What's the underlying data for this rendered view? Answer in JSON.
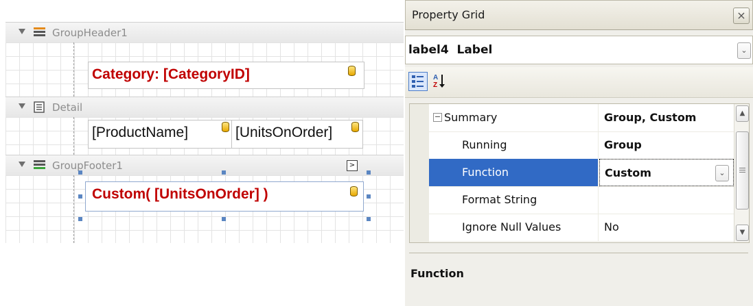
{
  "designer": {
    "bands": [
      {
        "name": "GroupHeader1"
      },
      {
        "name": "Detail"
      },
      {
        "name": "GroupFooter1"
      }
    ],
    "controls": {
      "category": "Category: [CategoryID]",
      "product_name": "[ProductName]",
      "units_on_order": "[UnitsOnOrder]",
      "custom_summary": "Custom( [UnitsOnOrder] )"
    },
    "smart_tag_glyph": ">"
  },
  "property_grid": {
    "title": "Property Grid",
    "close_glyph": "×",
    "object_selector": "label4  Label",
    "dropdown_glyph": "⌄",
    "rows": [
      {
        "name": "Summary",
        "value": "Group, Custom",
        "expander": "−"
      },
      {
        "name": "Running",
        "value": "Group"
      },
      {
        "name": "Function",
        "value": "Custom"
      },
      {
        "name": "Format String",
        "value": ""
      },
      {
        "name": "Ignore Null Values",
        "value": "No"
      }
    ],
    "description_title": "Function"
  },
  "icons": {
    "band_header": "group-header-band-icon",
    "band_detail": "detail-band-icon",
    "band_footer": "group-footer-band-icon",
    "bound_data": "database-icon",
    "categorized": "categorized-view-icon",
    "alphabetical": "alphabetical-sort-icon"
  },
  "colors": {
    "bound_text": "#c00000",
    "selection": "#316ac5",
    "handle": "#5b86c2"
  }
}
